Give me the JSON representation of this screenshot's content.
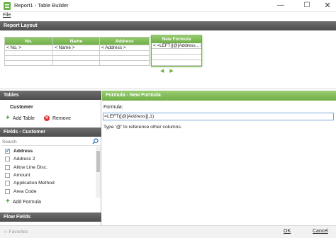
{
  "window": {
    "title": "Report1 - Table Builder",
    "minimize": "—",
    "maximize": "☐",
    "close": "✕"
  },
  "menu": {
    "file": "File"
  },
  "report_layout": {
    "header": "Report Layout",
    "columns": [
      {
        "label": "No.",
        "cell": "< No. >"
      },
      {
        "label": "Name",
        "cell": "< Name >"
      },
      {
        "label": "Address",
        "cell": "< Address >"
      }
    ],
    "new_column": {
      "label": "New Formula",
      "cell": "< =LEFT([@[Address... >"
    },
    "nav_left": "◀",
    "nav_right": "▶"
  },
  "tables": {
    "header": "Tables",
    "items": [
      "Customer"
    ],
    "add_label": "Add Table",
    "remove_label": "Remove"
  },
  "fields": {
    "header": "Fields - Customer",
    "search_placeholder": "Search",
    "items": [
      {
        "label": "Address",
        "checked": true
      },
      {
        "label": "Address 2",
        "checked": false
      },
      {
        "label": "Allow Line Disc.",
        "checked": false
      },
      {
        "label": "Amount",
        "checked": false
      },
      {
        "label": "Application Method",
        "checked": false
      },
      {
        "label": "Area Code",
        "checked": false
      }
    ],
    "add_formula_label": "Add Formula"
  },
  "flow_fields": {
    "header": "Flow Fields"
  },
  "formula_panel": {
    "header": "Formula - New Formula",
    "label": "Formula:",
    "value": "=LEFT([@[Address]],1)",
    "hint": "Type '@' to reference other columns."
  },
  "footer": {
    "favorites": "Favorites",
    "ok": "OK",
    "cancel": "Cancel"
  },
  "colors": {
    "accent_green": "#6eae45",
    "dark_header": "#555555",
    "focus_blue": "#7aa7d8"
  }
}
